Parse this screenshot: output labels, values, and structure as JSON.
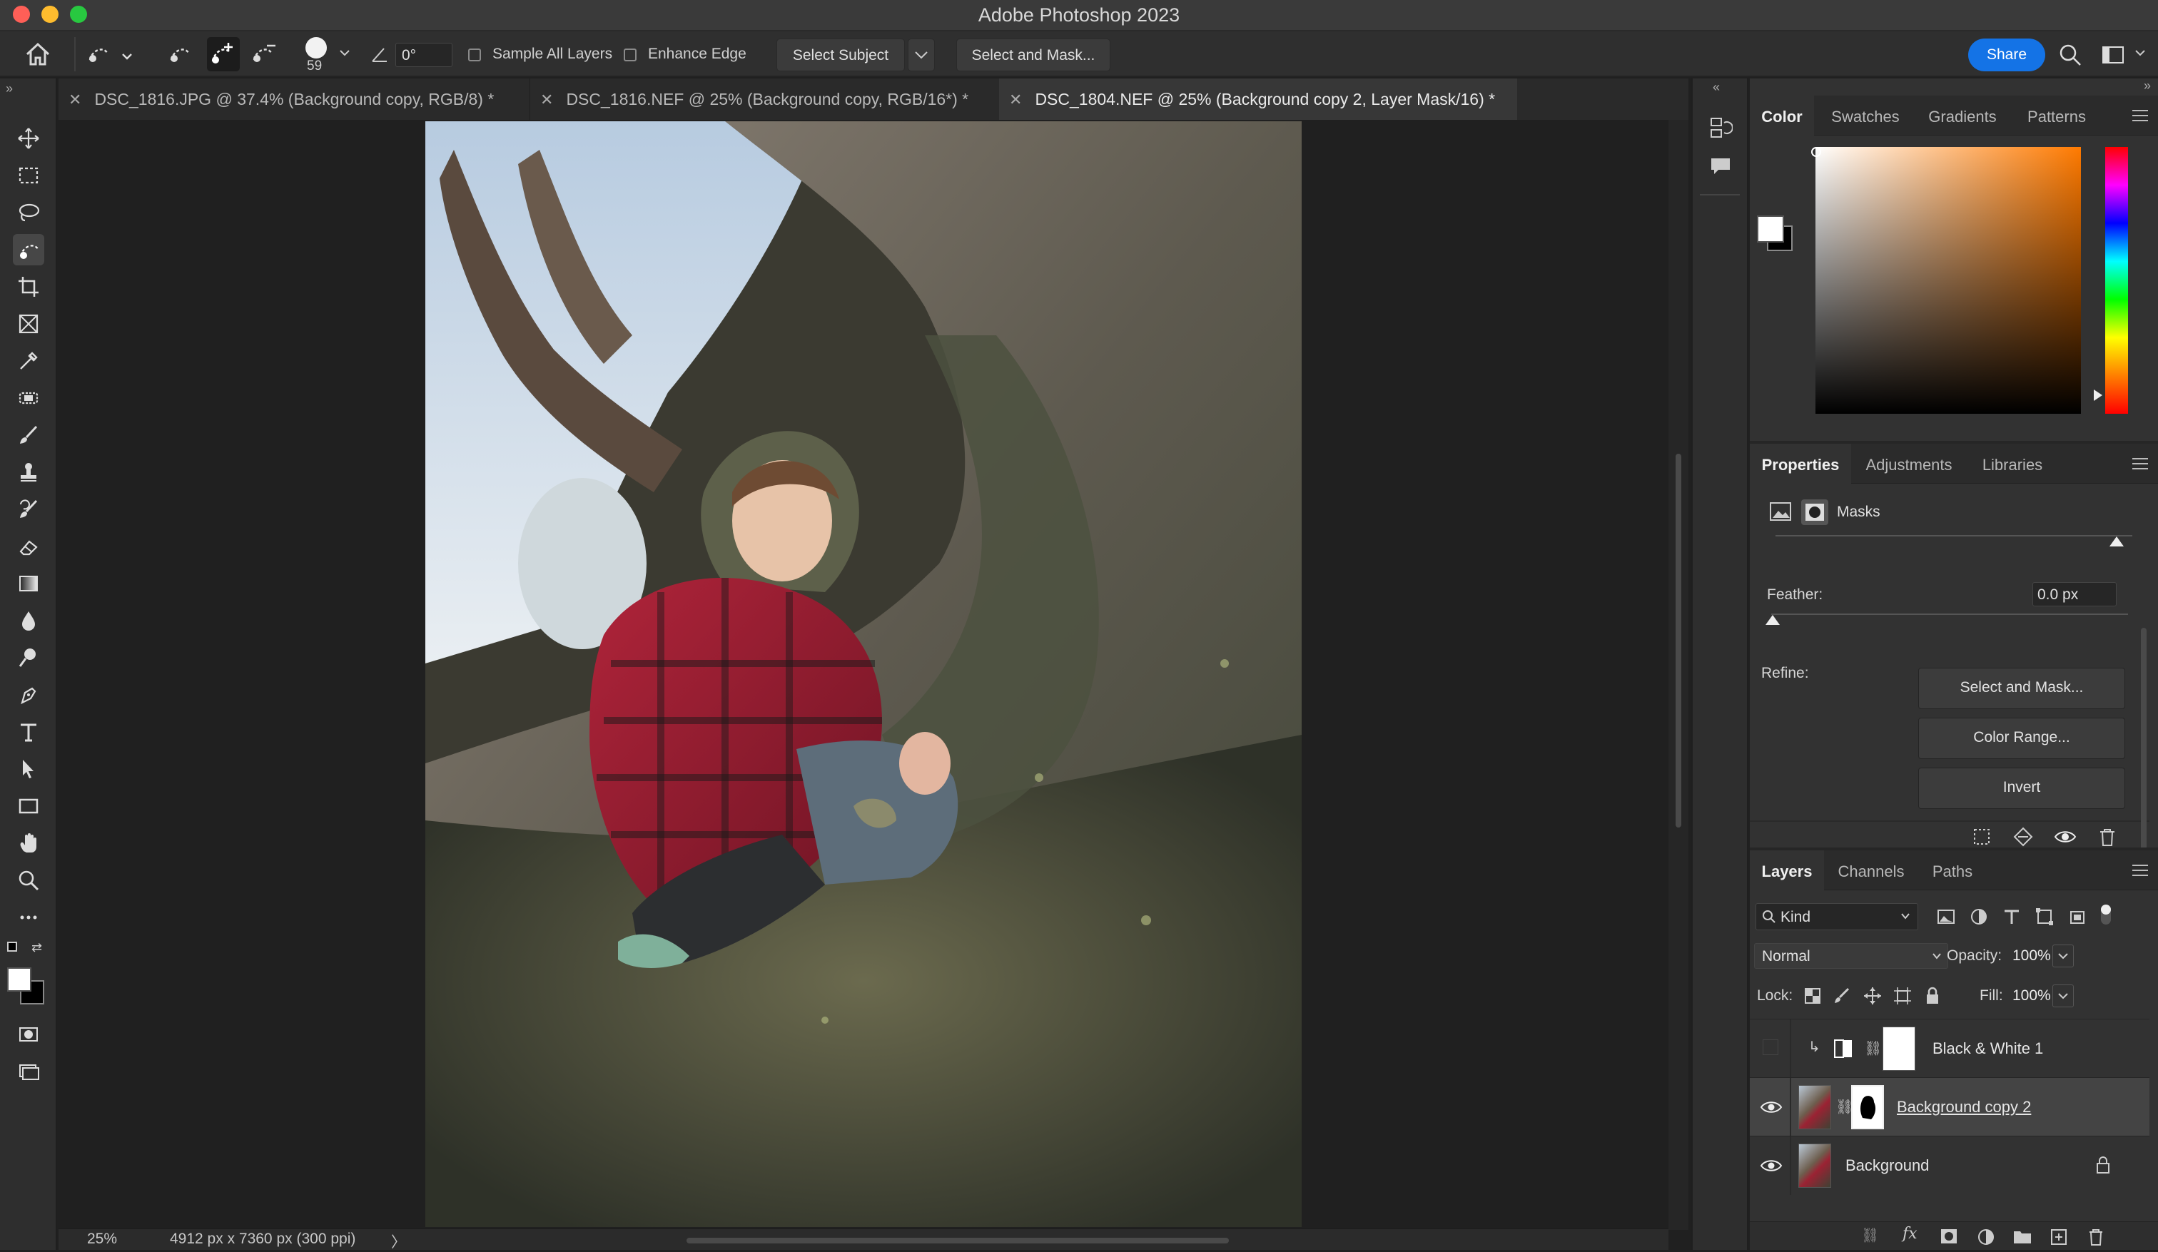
{
  "window": {
    "title": "Adobe Photoshop 2023"
  },
  "options_bar": {
    "brush_size": "59",
    "angle": "0°",
    "sample_all_layers": "Sample All Layers",
    "enhance_edge": "Enhance Edge",
    "select_subject": "Select Subject",
    "select_and_mask": "Select and Mask...",
    "share": "Share"
  },
  "doc_tabs": [
    {
      "label": "DSC_1816.JPG @ 37.4% (Background copy, RGB/8) *"
    },
    {
      "label": "DSC_1816.NEF @ 25% (Background copy, RGB/16*) *"
    },
    {
      "label": "DSC_1804.NEF @ 25% (Background copy 2, Layer Mask/16) *"
    }
  ],
  "status": {
    "zoom": "25%",
    "doc_info": "4912 px x 7360 px (300 ppi)",
    "arrow": "〉"
  },
  "color_panel": {
    "tabs": [
      "Color",
      "Swatches",
      "Gradients",
      "Patterns"
    ]
  },
  "properties_panel": {
    "tabs": [
      "Properties",
      "Adjustments",
      "Libraries"
    ],
    "masks_label": "Masks",
    "feather_label": "Feather:",
    "feather_value": "0.0 px",
    "refine_label": "Refine:",
    "select_and_mask": "Select and Mask...",
    "color_range": "Color Range...",
    "invert": "Invert"
  },
  "layers_panel": {
    "tabs": [
      "Layers",
      "Channels",
      "Paths"
    ],
    "kind": "Kind",
    "blend_mode": "Normal",
    "opacity_label": "Opacity:",
    "opacity_value": "100%",
    "lock_label": "Lock:",
    "fill_label": "Fill:",
    "fill_value": "100%",
    "layers": [
      {
        "name": "Black & White 1",
        "visible": false
      },
      {
        "name": "Background copy 2",
        "visible": true,
        "selected": true
      },
      {
        "name": "Background",
        "visible": true,
        "locked": true
      }
    ]
  },
  "colors": {
    "accent": "#1473e6",
    "foreground": "#ffffff",
    "background": "#000000"
  }
}
